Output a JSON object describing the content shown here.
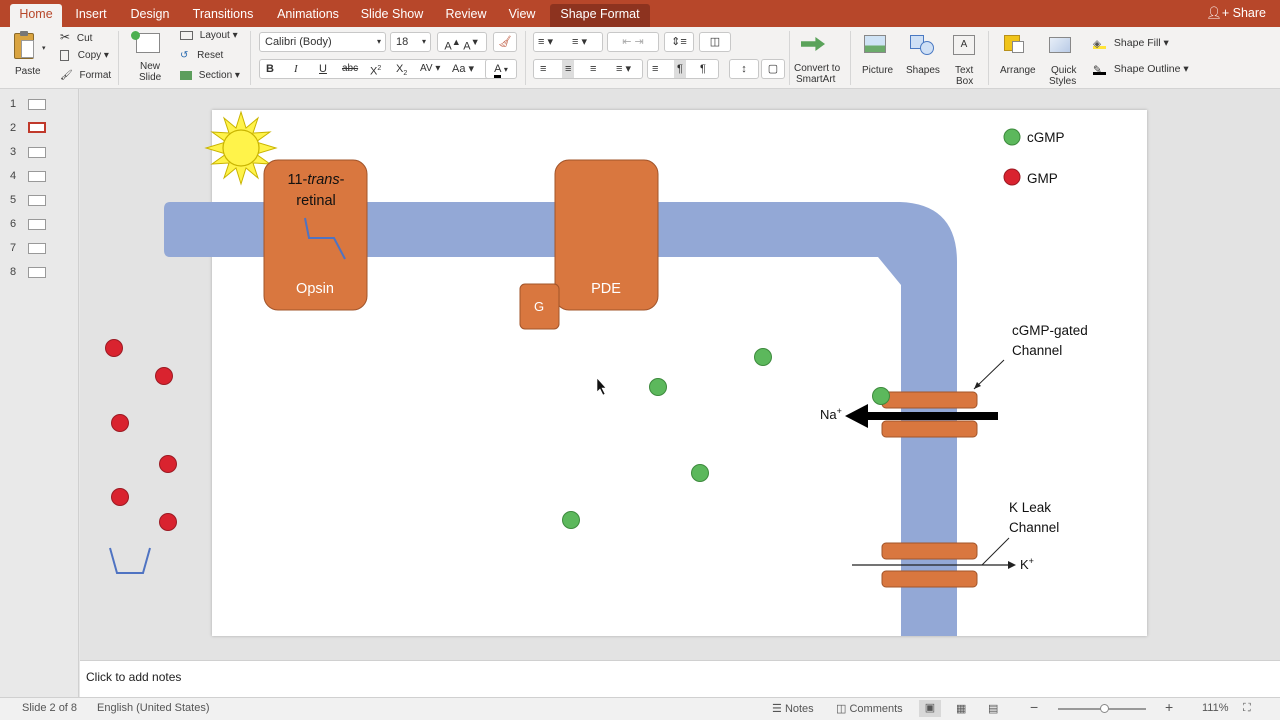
{
  "ribbon_tabs": [
    "Home",
    "Insert",
    "Design",
    "Transitions",
    "Animations",
    "Slide Show",
    "Review",
    "View",
    "Shape Format"
  ],
  "share_label": "Share",
  "clipboard": {
    "paste": "Paste",
    "cut": "Cut",
    "copy": "Copy",
    "format": "Format"
  },
  "slides_group": {
    "new_slide": "New Slide",
    "layout": "Layout",
    "reset": "Reset",
    "section": "Section"
  },
  "font": {
    "family": "Calibri (Body)",
    "size": "18"
  },
  "insert_group": {
    "convert": "Convert to SmartArt",
    "picture": "Picture",
    "shapes": "Shapes",
    "text_box": "Text Box",
    "arrange": "Arrange",
    "quick_styles": "Quick Styles",
    "shape_fill": "Shape Fill",
    "shape_outline": "Shape Outline"
  },
  "slide_numbers": [
    "1",
    "2",
    "3",
    "4",
    "5",
    "6",
    "7",
    "8"
  ],
  "selected_slide": 2,
  "slide": {
    "retinal_label_1": "11-",
    "retinal_label_italic": "trans",
    "retinal_label_2": "-",
    "retinal_label_3": "retinal",
    "opsin_label": "Opsin",
    "pde_label": "PDE",
    "g_label": "G",
    "legend_cgmp": "cGMP",
    "legend_gmp": "GMP",
    "channel_label_1": "cGMP-gated",
    "channel_label_2": "Channel",
    "na_label": "Na",
    "na_sup": "+",
    "leak_label_1": "K Leak",
    "leak_label_2": "Channel",
    "k_label": "K",
    "k_sup": "+"
  },
  "colors": {
    "accent": "#b7472a",
    "membrane": "#93a8d6",
    "protein": "#d9773f",
    "cgmp": "#5cb85c",
    "gmp": "#d9232f",
    "sun": "#fff34a"
  },
  "notes_placeholder": "Click to add notes",
  "status": {
    "slide_info": "Slide 2 of 8",
    "language": "English (United States)",
    "notes": "Notes",
    "comments": "Comments",
    "zoom": "111%"
  }
}
